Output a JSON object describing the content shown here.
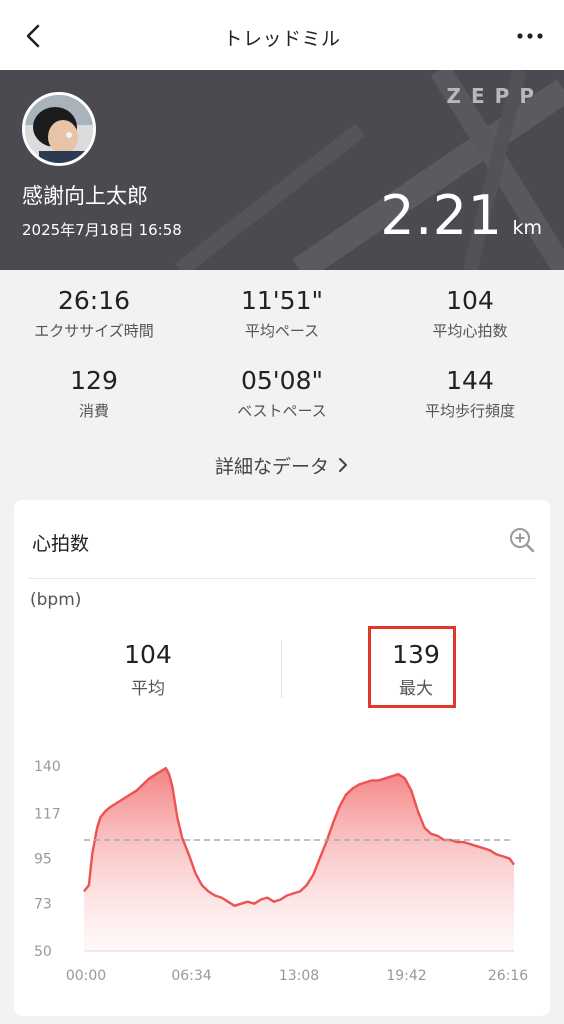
{
  "header": {
    "title": "トレッドミル"
  },
  "banner": {
    "brand": "ZEPP",
    "user_name": "感謝向上太郎",
    "date": "2025年7月18日 16:58",
    "distance_value": "2.21",
    "distance_unit": "km"
  },
  "stats": [
    {
      "value": "26:16",
      "label": "エクササイズ時間"
    },
    {
      "value": "11'51\"",
      "label": "平均ペース"
    },
    {
      "value": "104",
      "label": "平均心拍数"
    },
    {
      "value": "129",
      "label": "消費"
    },
    {
      "value": "05'08\"",
      "label": "ベストペース"
    },
    {
      "value": "144",
      "label": "平均歩行頻度"
    }
  ],
  "detail_link": "詳細なデータ",
  "heart_card": {
    "title": "心拍数",
    "unit": "(bpm)",
    "average": {
      "value": "104",
      "label": "平均"
    },
    "max": {
      "value": "139",
      "label": "最大"
    },
    "highlight_color": "#e0392b"
  },
  "chart_data": {
    "type": "area",
    "ylim": [
      50,
      140
    ],
    "y_ticks": [
      "140",
      "117",
      "95",
      "73",
      "50"
    ],
    "x_ticks": [
      "00:00",
      "06:34",
      "13:08",
      "19:42",
      "26:16"
    ],
    "xlim": [
      0,
      26.27
    ],
    "average_line": 104,
    "fill_color": "#f26b6b",
    "x": [
      0.0,
      0.3,
      0.5,
      0.8,
      1.0,
      1.3,
      1.6,
      2.0,
      2.4,
      2.8,
      3.2,
      3.6,
      4.0,
      4.4,
      4.8,
      5.0,
      5.2,
      5.4,
      5.7,
      6.0,
      6.4,
      6.8,
      7.2,
      7.6,
      8.0,
      8.4,
      8.8,
      9.2,
      9.6,
      10.0,
      10.4,
      10.8,
      11.2,
      11.6,
      12.0,
      12.4,
      12.8,
      13.2,
      13.6,
      14.0,
      14.4,
      14.8,
      15.2,
      15.6,
      16.0,
      16.4,
      16.8,
      17.2,
      17.6,
      18.0,
      18.4,
      18.8,
      19.2,
      19.6,
      20.0,
      20.4,
      20.8,
      21.2,
      21.6,
      22.0,
      22.4,
      22.8,
      23.2,
      23.6,
      24.0,
      24.4,
      24.8,
      25.2,
      25.6,
      26.0,
      26.27
    ],
    "y": [
      79,
      82,
      97,
      110,
      115,
      118,
      120,
      122,
      124,
      126,
      128,
      131,
      134,
      136,
      138,
      139,
      136,
      130,
      115,
      105,
      97,
      88,
      82,
      79,
      77,
      76,
      74,
      72,
      73,
      74,
      73,
      75,
      76,
      74,
      75,
      77,
      78,
      79,
      82,
      87,
      95,
      103,
      112,
      120,
      126,
      129,
      131,
      132,
      133,
      133,
      134,
      135,
      136,
      134,
      128,
      118,
      110,
      107,
      106,
      104,
      104,
      103,
      103,
      102,
      101,
      100,
      99,
      97,
      96,
      95,
      92
    ]
  }
}
